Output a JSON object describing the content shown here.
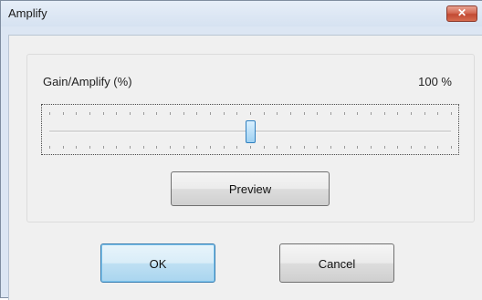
{
  "window": {
    "title": "Amplify",
    "close_glyph": "✕",
    "close_icon": "close-icon"
  },
  "gain": {
    "label": "Gain/Amplify (%)",
    "value_text": "100 %",
    "slider_position_fraction": 0.5
  },
  "buttons": {
    "preview": "Preview",
    "ok": "OK",
    "cancel": "Cancel"
  },
  "colors": {
    "accent": "#3c7fb1",
    "thumb": "#9fd1f2",
    "close": "#c24a33"
  }
}
